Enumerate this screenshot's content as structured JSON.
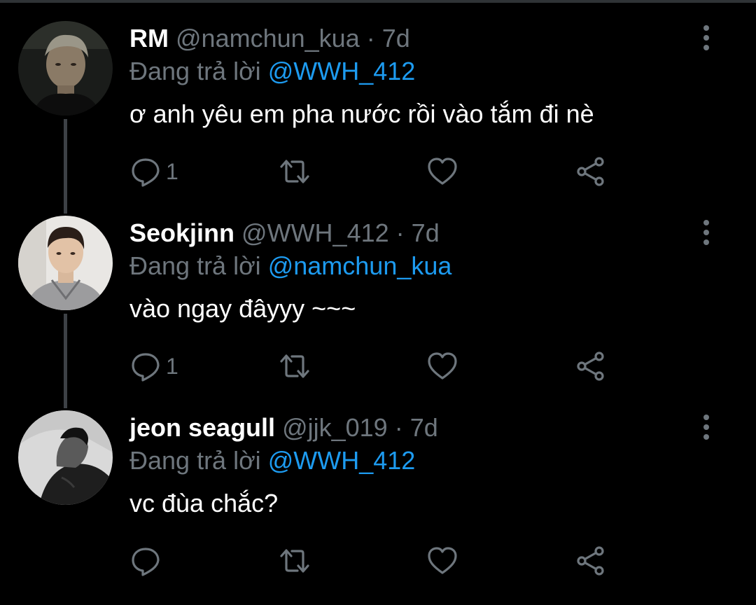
{
  "colors": {
    "background": "#000000",
    "text_primary": "#ffffff",
    "text_secondary": "#6e767d",
    "link": "#1d9bf0",
    "thread_line": "#3d4146"
  },
  "tweets": [
    {
      "display_name": "RM",
      "handle": "@namchun_kua",
      "separator": "·",
      "time": "7d",
      "reply_prefix": "Đang trả lời",
      "reply_to": "@WWH_412",
      "text": "ơ anh yêu em pha nước rồi vào tắm đi nè",
      "reply_count": "1",
      "avatar_icon": "avatar-photo-rm",
      "icons": [
        "reply-icon",
        "retweet-icon",
        "like-icon",
        "share-icon",
        "more-options-icon"
      ]
    },
    {
      "display_name": "Seokjinn",
      "handle": "@WWH_412",
      "separator": "·",
      "time": "7d",
      "reply_prefix": "Đang trả lời",
      "reply_to": "@namchun_kua",
      "text": "vào ngay đâyyy ~~~",
      "reply_count": "1",
      "avatar_icon": "avatar-photo-seokjinn",
      "icons": [
        "reply-icon",
        "retweet-icon",
        "like-icon",
        "share-icon",
        "more-options-icon"
      ]
    },
    {
      "display_name": "jeon seagull",
      "handle": "@jjk_019",
      "separator": "·",
      "time": "7d",
      "reply_prefix": "Đang trả lời",
      "reply_to": "@WWH_412",
      "text": "vc đùa chắc?",
      "reply_count": "",
      "avatar_icon": "avatar-photo-jeon-seagull",
      "icons": [
        "reply-icon",
        "retweet-icon",
        "like-icon",
        "share-icon",
        "more-options-icon"
      ]
    }
  ]
}
